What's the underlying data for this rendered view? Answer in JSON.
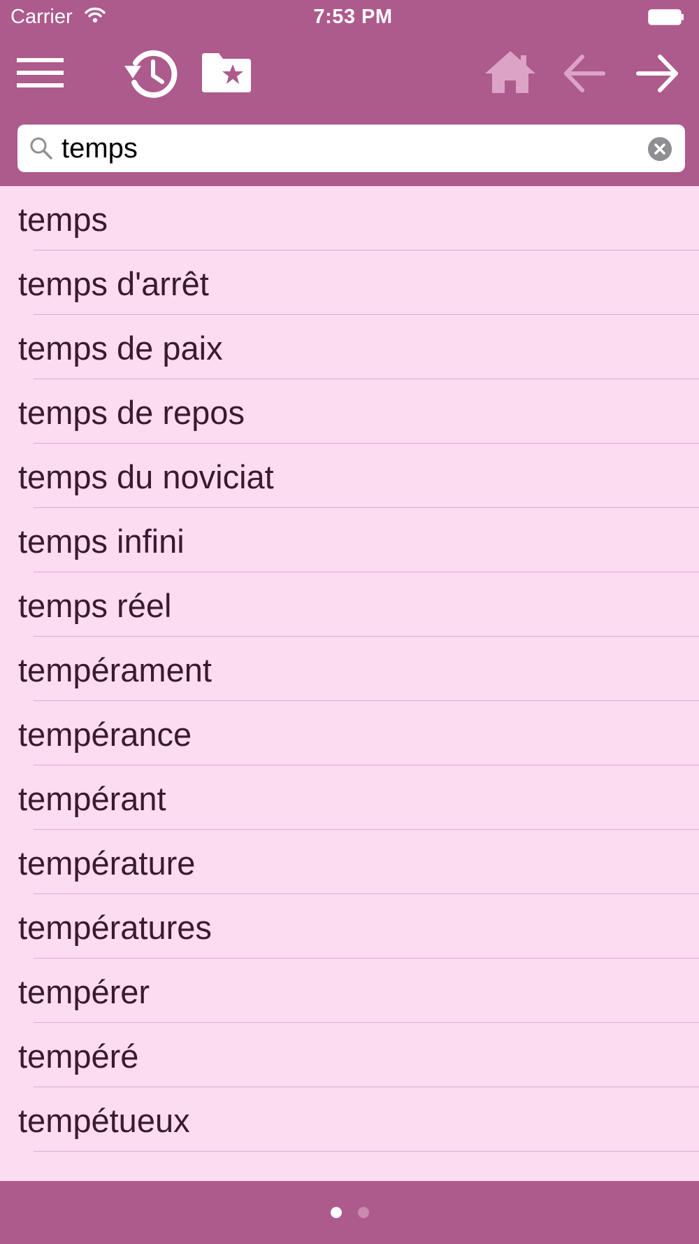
{
  "status_bar": {
    "carrier": "Carrier",
    "time": "7:53 PM"
  },
  "toolbar": {
    "buttons": [
      {
        "name": "menu",
        "icon": "hamburger-menu-icon",
        "enabled": true
      },
      {
        "name": "history",
        "icon": "history-clock-icon",
        "enabled": true
      },
      {
        "name": "favorites",
        "icon": "star-folder-icon",
        "enabled": true
      },
      {
        "name": "home",
        "icon": "home-icon",
        "enabled": false
      },
      {
        "name": "back",
        "icon": "arrow-left-icon",
        "enabled": false
      },
      {
        "name": "forward",
        "icon": "arrow-right-icon",
        "enabled": true
      }
    ]
  },
  "search": {
    "value": "temps",
    "clear_icon": "clear-x-icon"
  },
  "results": [
    {
      "label": "temps"
    },
    {
      "label": "temps d'arrêt"
    },
    {
      "label": "temps de paix"
    },
    {
      "label": "temps de repos"
    },
    {
      "label": "temps du noviciat"
    },
    {
      "label": "temps infini"
    },
    {
      "label": "temps réel"
    },
    {
      "label": "tempérament"
    },
    {
      "label": "tempérance"
    },
    {
      "label": "tempérant"
    },
    {
      "label": "température"
    },
    {
      "label": "températures"
    },
    {
      "label": "tempérer"
    },
    {
      "label": "tempéré"
    },
    {
      "label": "tempétueux"
    }
  ],
  "pagination": {
    "total_pages": 2,
    "current_page": 1
  },
  "colors": {
    "header": "#ad5a8c",
    "background": "#fcdcf0",
    "separator": "#e3a9d3",
    "text": "#3a1a2e",
    "disabled_icon": "#dda3c6"
  }
}
